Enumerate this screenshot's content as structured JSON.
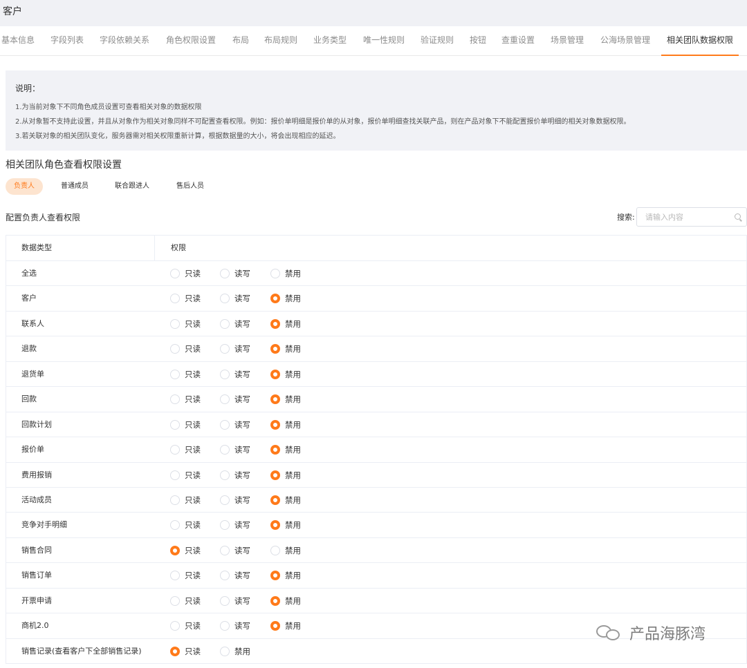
{
  "header": {
    "object_title": "客户"
  },
  "tabs": [
    {
      "label": "基本信息"
    },
    {
      "label": "字段列表"
    },
    {
      "label": "字段依赖关系"
    },
    {
      "label": "角色权限设置"
    },
    {
      "label": "布局"
    },
    {
      "label": "布局规则"
    },
    {
      "label": "业务类型"
    },
    {
      "label": "唯一性规则"
    },
    {
      "label": "验证规则"
    },
    {
      "label": "按钮"
    },
    {
      "label": "查重设置"
    },
    {
      "label": "场景管理"
    },
    {
      "label": "公海场景管理"
    },
    {
      "label": "相关团队数据权限",
      "active": true
    }
  ],
  "notes": {
    "title": "说明：",
    "lines": [
      "1.为当前对象下不同角色成员设置可查看相关对象的数据权限",
      "2.从对象暂不支持此设置，并且从对象作为相关对象同样不可配置查看权限。例如：报价单明细是报价单的从对象，报价单明细查找关联产品，则在产品对象下不能配置报价单明细的相关对象数据权限。",
      "3.若关联对象的相关团队变化，服务器需对相关权限重新计算，根据数据量的大小，将会出现相应的延迟。"
    ]
  },
  "section_title": "相关团队角色查看权限设置",
  "roles": [
    {
      "label": "负责人",
      "active": true
    },
    {
      "label": "普通成员"
    },
    {
      "label": "联合跟进人"
    },
    {
      "label": "售后人员"
    }
  ],
  "config_label": "配置负责人查看权限",
  "search": {
    "label": "搜索:",
    "placeholder": "请输入内容"
  },
  "table": {
    "col_type": "数据类型",
    "col_perm": "权限",
    "opt_readonly": "只读",
    "opt_readwrite": "读写",
    "opt_disabled": "禁用",
    "rows": [
      {
        "type": "全选",
        "selected": ""
      },
      {
        "type": "客户",
        "selected": "禁用"
      },
      {
        "type": "联系人",
        "selected": "禁用"
      },
      {
        "type": "退款",
        "selected": "禁用"
      },
      {
        "type": "退货单",
        "selected": "禁用"
      },
      {
        "type": "回款",
        "selected": "禁用"
      },
      {
        "type": "回款计划",
        "selected": "禁用"
      },
      {
        "type": "报价单",
        "selected": "禁用"
      },
      {
        "type": "费用报销",
        "selected": "禁用"
      },
      {
        "type": "活动成员",
        "selected": "禁用"
      },
      {
        "type": "竞争对手明细",
        "selected": "禁用"
      },
      {
        "type": "销售合同",
        "selected": "只读"
      },
      {
        "type": "销售订单",
        "selected": "禁用"
      },
      {
        "type": "开票申请",
        "selected": "禁用"
      },
      {
        "type": "商机2.0",
        "selected": "禁用"
      },
      {
        "type": "销售记录(查看客户下全部销售记录)",
        "selected": "只读",
        "two_options": true
      }
    ]
  },
  "watermark": {
    "text": "产品海豚湾"
  }
}
